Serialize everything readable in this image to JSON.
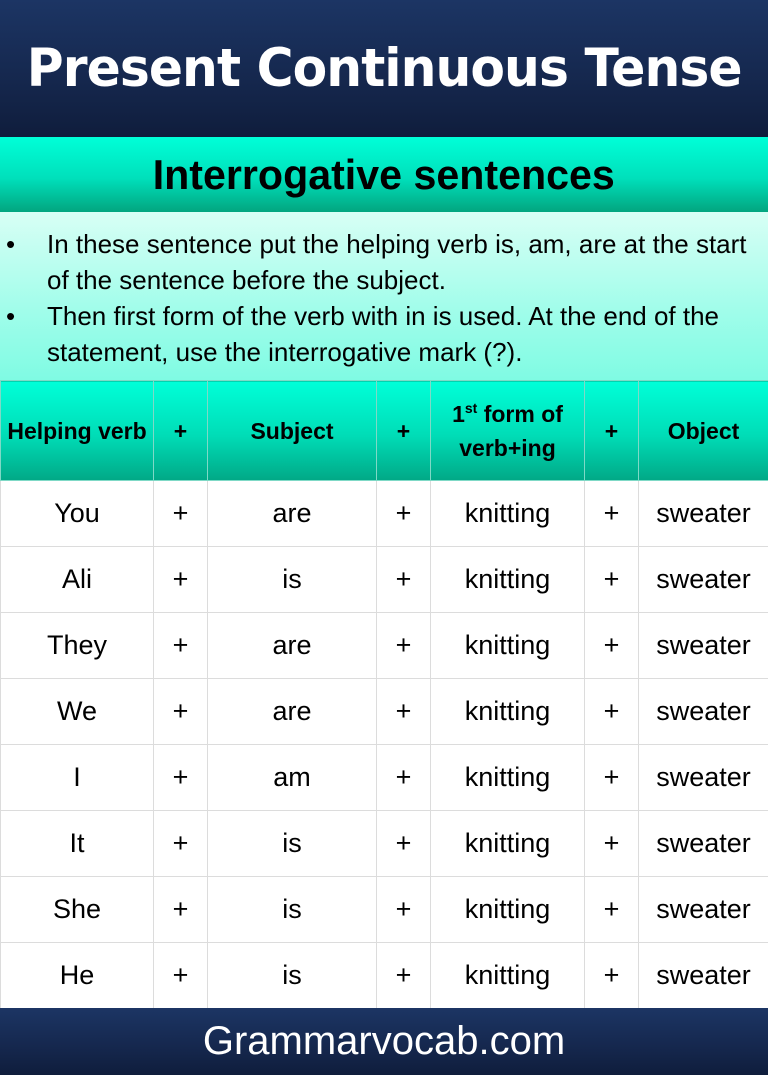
{
  "header": {
    "title": "Present Continuous Tense"
  },
  "subheader": {
    "title": "Interrogative sentences"
  },
  "notes": [
    "In these sentence put the helping verb is, am, are at the start of the sentence before the subject.",
    "Then first form of the verb with in is used. At the end of the statement, use the interrogative mark (?)."
  ],
  "bullet_glyph": "•",
  "table": {
    "headers": {
      "col1": "Helping verb",
      "plus": "+",
      "col2": "Subject",
      "col3_prefix": "1",
      "col3_sup": "st",
      "col3_rest": " form of verb+ing",
      "col4": "Object"
    },
    "rows": [
      [
        "You",
        "+",
        "are",
        "+",
        "knitting",
        "+",
        "sweater"
      ],
      [
        "Ali",
        "+",
        "is",
        "+",
        "knitting",
        "+",
        "sweater"
      ],
      [
        "They",
        "+",
        "are",
        "+",
        "knitting",
        "+",
        "sweater"
      ],
      [
        "We",
        "+",
        "are",
        "+",
        "knitting",
        "+",
        "sweater"
      ],
      [
        "I",
        "+",
        "am",
        "+",
        "knitting",
        "+",
        "sweater"
      ],
      [
        "It",
        "+",
        "is",
        "+",
        "knitting",
        "+",
        "sweater"
      ],
      [
        "She",
        "+",
        "is",
        "+",
        "knitting",
        "+",
        "sweater"
      ],
      [
        "He",
        "+",
        "is",
        "+",
        "knitting",
        "+",
        "sweater"
      ]
    ]
  },
  "footer": {
    "text": "Grammarvocab.com"
  },
  "colors": {
    "navy": "#15274d",
    "teal": "#00e0bb",
    "mint": "#9ffdea"
  }
}
